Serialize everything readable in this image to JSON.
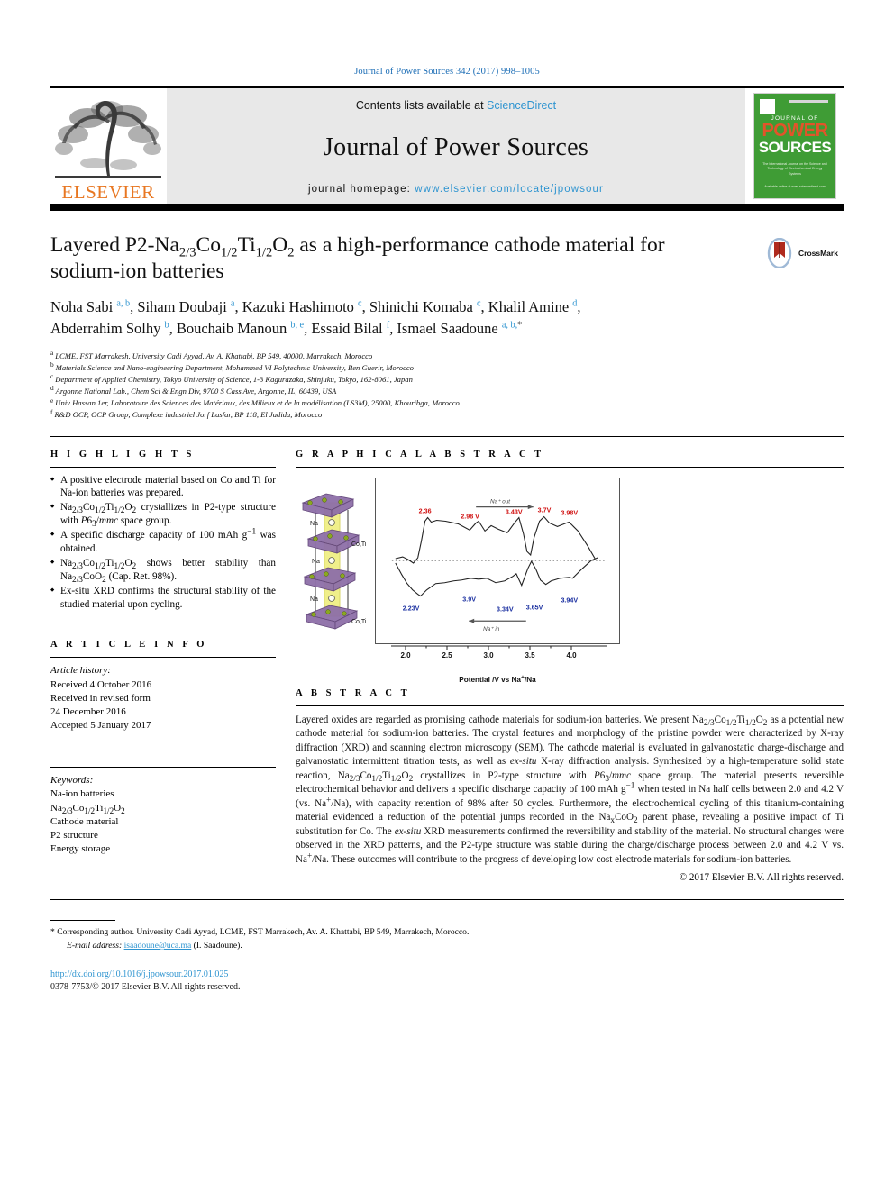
{
  "running_head": "Journal of Power Sources 342 (2017) 998–1005",
  "masthead": {
    "contents_prefix": "Contents lists available at ",
    "sciencedirect": "ScienceDirect",
    "journal_title": "Journal of Power Sources",
    "homepage_prefix": "journal homepage: ",
    "homepage_url": "www.elsevier.com/locate/jpowsour",
    "publisher_wordmark": "ELSEVIER",
    "publisher_color": "#E87722",
    "link_color": "#2e94d0",
    "cover": {
      "kicker": "JOURNAL OF",
      "word1": "POWER",
      "word2": "SOURCES",
      "subtitle": "The International Journal on the Science and Technology of Electrochemical Energy Systems",
      "footer": "Available online at www.sciencedirect.com",
      "bg_color": "#3f9c35",
      "accent_color": "#e2542a"
    }
  },
  "article": {
    "title_line1": "Layered P2-Na",
    "title_sub1": "2/3",
    "title_mid1": "Co",
    "title_sub2": "1/2",
    "title_mid2": "Ti",
    "title_sub3": "1/2",
    "title_mid3": "O",
    "title_sub4": "2",
    "title_tail": " as a high-performance cathode material for sodium-ion batteries",
    "crossmark_label": "CrossMark",
    "authors_line1_parts": "Noha Sabi a, b, Siham Doubaji a, Kazuki Hashimoto c, Shinichi Komaba c, Khalil Amine d,",
    "authors_line2_parts": "Abderrahim Solhy b, Bouchaib Manoun b, e, Essaid Bilal f, Ismael Saadoune a, b, *",
    "affiliations": [
      {
        "mark": "a",
        "text": "LCME, FST Marrakesh, University Cadi Ayyad, Av. A. Khattabi, BP 549, 40000, Marrakech, Morocco"
      },
      {
        "mark": "b",
        "text": "Materials Science and Nano-engineering Department, Mohammed VI Polytechnic University, Ben Guerir, Morocco"
      },
      {
        "mark": "c",
        "text": "Department of Applied Chemistry, Tokyo University of Science, 1-3 Kagurazaka, Shinjuku, Tokyo, 162-8061, Japan"
      },
      {
        "mark": "d",
        "text": "Argonne National Lab., Chem Sci & Engn Div, 9700 S Cass Ave, Argonne, IL, 60439, USA"
      },
      {
        "mark": "e",
        "text": "Univ Hassan 1er, Laboratoire des Sciences des Matériaux, des Milieux et de la modélisation (LS3M), 25000, Khouribga, Morocco"
      },
      {
        "mark": "f",
        "text": "R&D OCP, OCP Group, Complexe industriel Jorf Lasfar, BP 118, El Jadida, Morocco"
      }
    ]
  },
  "highlights": {
    "heading": "H I G H L I G H T S",
    "items": [
      "A positive electrode material based on Co and Ti for Na-ion batteries was prepared.",
      "Na2/3Co1/2Ti1/2O2 crystallizes in P2-type structure with P63/mmc space group.",
      "A specific discharge capacity of 100 mAh g−1 was obtained.",
      "Na2/3Co1/2Ti1/2O2 shows better stability than Na2/3CoO2 (Cap. Ret. 98%).",
      "Ex-situ XRD confirms the structural stability of the studied material upon cycling."
    ]
  },
  "article_info": {
    "heading": "A R T I C L E  I N F O",
    "history_label": "Article history:",
    "history": [
      "Received 4 October 2016",
      "Received in revised form",
      "24 December 2016",
      "Accepted 5 January 2017"
    ],
    "keywords_label": "Keywords:",
    "keywords": [
      "Na-ion batteries",
      "Na2/3Co1/2Ti1/2O2",
      "Cathode material",
      "P2 structure",
      "Energy storage"
    ]
  },
  "graphical_abstract": {
    "heading": "G R A P H I C A L  A B S T R A C T",
    "structure_labels": [
      "Na",
      "Co,Ti",
      "Na",
      "Na",
      "Co,Ti"
    ],
    "structure_colors": {
      "polyhedra": "#8e6fa8",
      "prism": "#f0ef8a",
      "atom": "#8aa81f"
    }
  },
  "abstract": {
    "heading": "A B S T R A C T",
    "text": "Layered oxides are regarded as promising cathode materials for sodium-ion batteries. We present Na2/3Co1/2Ti1/2O2 as a potential new cathode material for sodium-ion batteries. The crystal features and morphology of the pristine powder were characterized by X-ray diffraction (XRD) and scanning electron microscopy (SEM). The cathode material is evaluated in galvanostatic charge-discharge and galvanostatic intermittent titration tests, as well as ex-situ X-ray diffraction analysis. Synthesized by a high-temperature solid state reaction, Na2/3Co1/2Ti1/2O2 crystallizes in P2-type structure with P63/mmc space group. The material presents reversible electrochemical behavior and delivers a specific discharge capacity of 100 mAh g−1 when tested in Na half cells between 2.0 and 4.2 V (vs. Na+/Na), with capacity retention of 98% after 50 cycles. Furthermore, the electrochemical cycling of this titanium-containing material evidenced a reduction of the potential jumps recorded in the NaxCoO2 parent phase, revealing a positive impact of Ti substitution for Co. The ex-situ XRD measurements confirmed the reversibility and stability of the material. No structural changes were observed in the XRD patterns, and the P2-type structure was stable during the charge/discharge process between 2.0 and 4.2 V vs. Na+/Na. These outcomes will contribute to the progress of developing low cost electrode materials for sodium-ion batteries.",
    "copyright": "© 2017 Elsevier B.V. All rights reserved."
  },
  "footer": {
    "corresponding_marker": "*",
    "corresponding_text": "Corresponding author. University Cadi Ayyad, LCME, FST Marrakech, Av. A. Khattabi, BP 549, Marrakech, Morocco.",
    "email_label": "E-mail address:",
    "email": "isaadoune@uca.ma",
    "email_suffix": "(I. Saadoune).",
    "doi": "http://dx.doi.org/10.1016/j.jpowsour.2017.01.025",
    "issn": "0378-7753/© 2017 Elsevier B.V. All rights reserved."
  },
  "chart_data": {
    "type": "line",
    "title": "",
    "xlabel": "Potential /V vs Na+/Na",
    "ylabel": "",
    "xlim": [
      1.85,
      4.35
    ],
    "xticks": [
      2.0,
      2.5,
      3.0,
      3.5,
      4.0
    ],
    "xtick_labels": [
      "2.0",
      "2.5",
      "3.0",
      "3.5",
      "4.0"
    ],
    "grid": false,
    "legend": "none",
    "annotations": {
      "charge_arrow_label": "Na+ out",
      "discharge_arrow_label": "Na+ in",
      "charge_peaks_color": "#d01010",
      "discharge_peaks_color": "#1a2fa0"
    },
    "series": [
      {
        "name": "charge (Na+ out)",
        "color": "#222222",
        "peak_labels": [
          "2.36",
          "2.98 V",
          "3.43V",
          "3.7V",
          "3.98V"
        ],
        "peak_potentials": [
          2.36,
          2.98,
          3.43,
          3.7,
          3.98
        ],
        "x": [
          1.95,
          2.05,
          2.12,
          2.2,
          2.26,
          2.3,
          2.34,
          2.36,
          2.4,
          2.45,
          2.55,
          2.7,
          2.85,
          2.95,
          2.98,
          3.05,
          3.12,
          3.2,
          3.3,
          3.38,
          3.43,
          3.48,
          3.52,
          3.56,
          3.6,
          3.65,
          3.7,
          3.76,
          3.85,
          3.95,
          3.98,
          4.08,
          4.18,
          4.25
        ],
        "y": [
          0.02,
          0.05,
          0.03,
          -0.02,
          0.04,
          0.35,
          0.72,
          0.8,
          0.74,
          0.76,
          0.75,
          0.72,
          0.62,
          0.7,
          0.72,
          0.6,
          0.66,
          0.62,
          0.58,
          0.68,
          0.74,
          0.55,
          0.25,
          0.2,
          0.42,
          0.66,
          0.72,
          0.66,
          0.63,
          0.66,
          0.67,
          0.55,
          0.3,
          0.02
        ]
      },
      {
        "name": "discharge (Na+ in)",
        "color": "#222222",
        "peak_labels": [
          "2.23V",
          "3.9V",
          "3.34V",
          "3.65V",
          "3.94V"
        ],
        "peak_potentials": [
          2.23,
          3.9,
          3.34,
          3.65,
          3.94
        ],
        "x": [
          1.95,
          2.02,
          2.08,
          2.14,
          2.2,
          2.23,
          2.3,
          2.4,
          2.5,
          2.6,
          2.7,
          2.8,
          2.9,
          3.0,
          3.1,
          3.2,
          3.3,
          3.34,
          3.4,
          3.46,
          3.5,
          3.55,
          3.6,
          3.65,
          3.7,
          3.8,
          3.9,
          3.94,
          4.05,
          4.15,
          4.25
        ],
        "y": [
          -0.05,
          -0.3,
          -0.5,
          -0.62,
          -0.7,
          -0.72,
          -0.62,
          -0.52,
          -0.5,
          -0.48,
          -0.47,
          -0.44,
          -0.46,
          -0.45,
          -0.5,
          -0.48,
          -0.42,
          -0.38,
          -0.55,
          -0.3,
          -0.16,
          -0.3,
          -0.48,
          -0.56,
          -0.5,
          -0.46,
          -0.44,
          -0.45,
          -0.3,
          -0.1,
          0.01
        ]
      }
    ]
  }
}
